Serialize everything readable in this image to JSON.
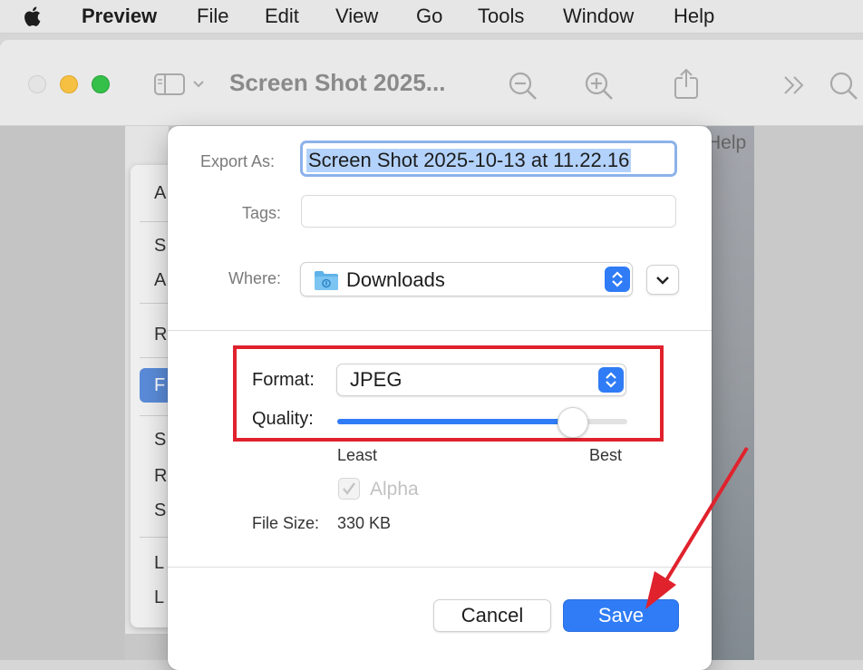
{
  "menubar": {
    "app": "Preview",
    "items": [
      "File",
      "Edit",
      "View",
      "Go",
      "Tools",
      "Window",
      "Help"
    ]
  },
  "window": {
    "title": "Screen Shot 2025...",
    "behind_menu_letters": [
      "A",
      "S",
      "A",
      "R",
      "F",
      "S",
      "R",
      "S",
      "L",
      "L"
    ],
    "behind_help": "Help"
  },
  "sheet": {
    "export_as_label": "Export As:",
    "export_as_value": "Screen Shot 2025-10-13 at 11.22.16",
    "tags_label": "Tags:",
    "where_label": "Where:",
    "where_value": "Downloads",
    "format_label": "Format:",
    "format_value": "JPEG",
    "quality_label": "Quality:",
    "quality_value": 0.81,
    "quality_min": "Least",
    "quality_max": "Best",
    "alpha_label": "Alpha",
    "alpha_checked": true,
    "file_size_label": "File Size:",
    "file_size_value": "330 KB",
    "cancel_label": "Cancel",
    "save_label": "Save"
  },
  "colors": {
    "accent": "#2f7cf6",
    "highlight": "#e0222d"
  }
}
